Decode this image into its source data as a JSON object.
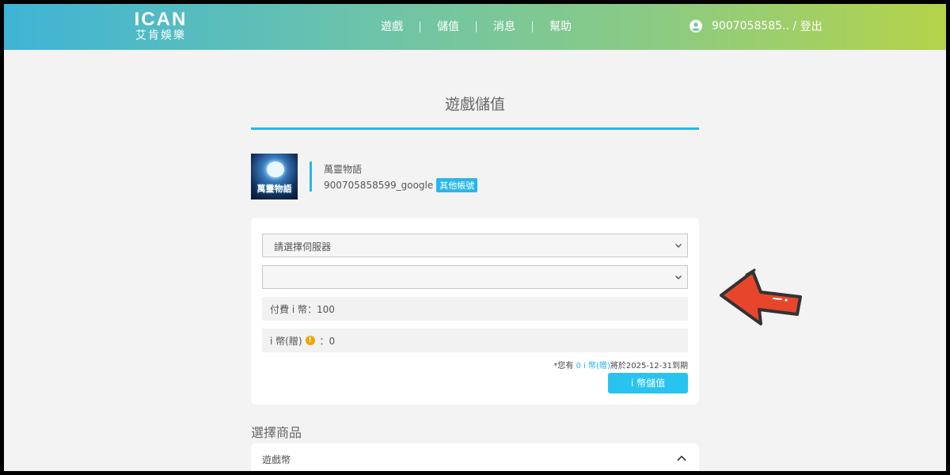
{
  "header": {
    "logo_mark": "ICAN",
    "logo_sub": "艾肯娛樂",
    "nav": [
      "遊戲",
      "儲值",
      "消息",
      "幫助"
    ],
    "user_id": "9007058585..",
    "logout_sep": " / ",
    "logout_label": "登出",
    "gradient_colors": [
      "#3fb4d6",
      "#b5d34a"
    ]
  },
  "page": {
    "title": "遊戲儲值"
  },
  "game": {
    "cover_text": "萬靈物語",
    "name": "萬靈物語",
    "account": "900705858599_google",
    "other_accounts_label": "其他帳號"
  },
  "form": {
    "server_select": "請選擇伺服器",
    "second_select": "",
    "paid_coin_label": "付費 i 幣：100",
    "gift_coin_label": "i 幣(贈)",
    "gift_coin_info_icon": "!",
    "gift_coin_value": "：0",
    "expiry_prefix": "*您有 ",
    "expiry_highlight": "0 i 幣(贈)",
    "expiry_suffix": "將於2025-12-31到期",
    "topup_button": "i 幣儲值"
  },
  "products": {
    "section_title": "選擇商品",
    "category_label": "遊戲幣"
  },
  "colors": {
    "accent": "#29b6e8",
    "button": "#29c3f0",
    "arrow": "#e8462c",
    "coin": "#f4a400"
  }
}
